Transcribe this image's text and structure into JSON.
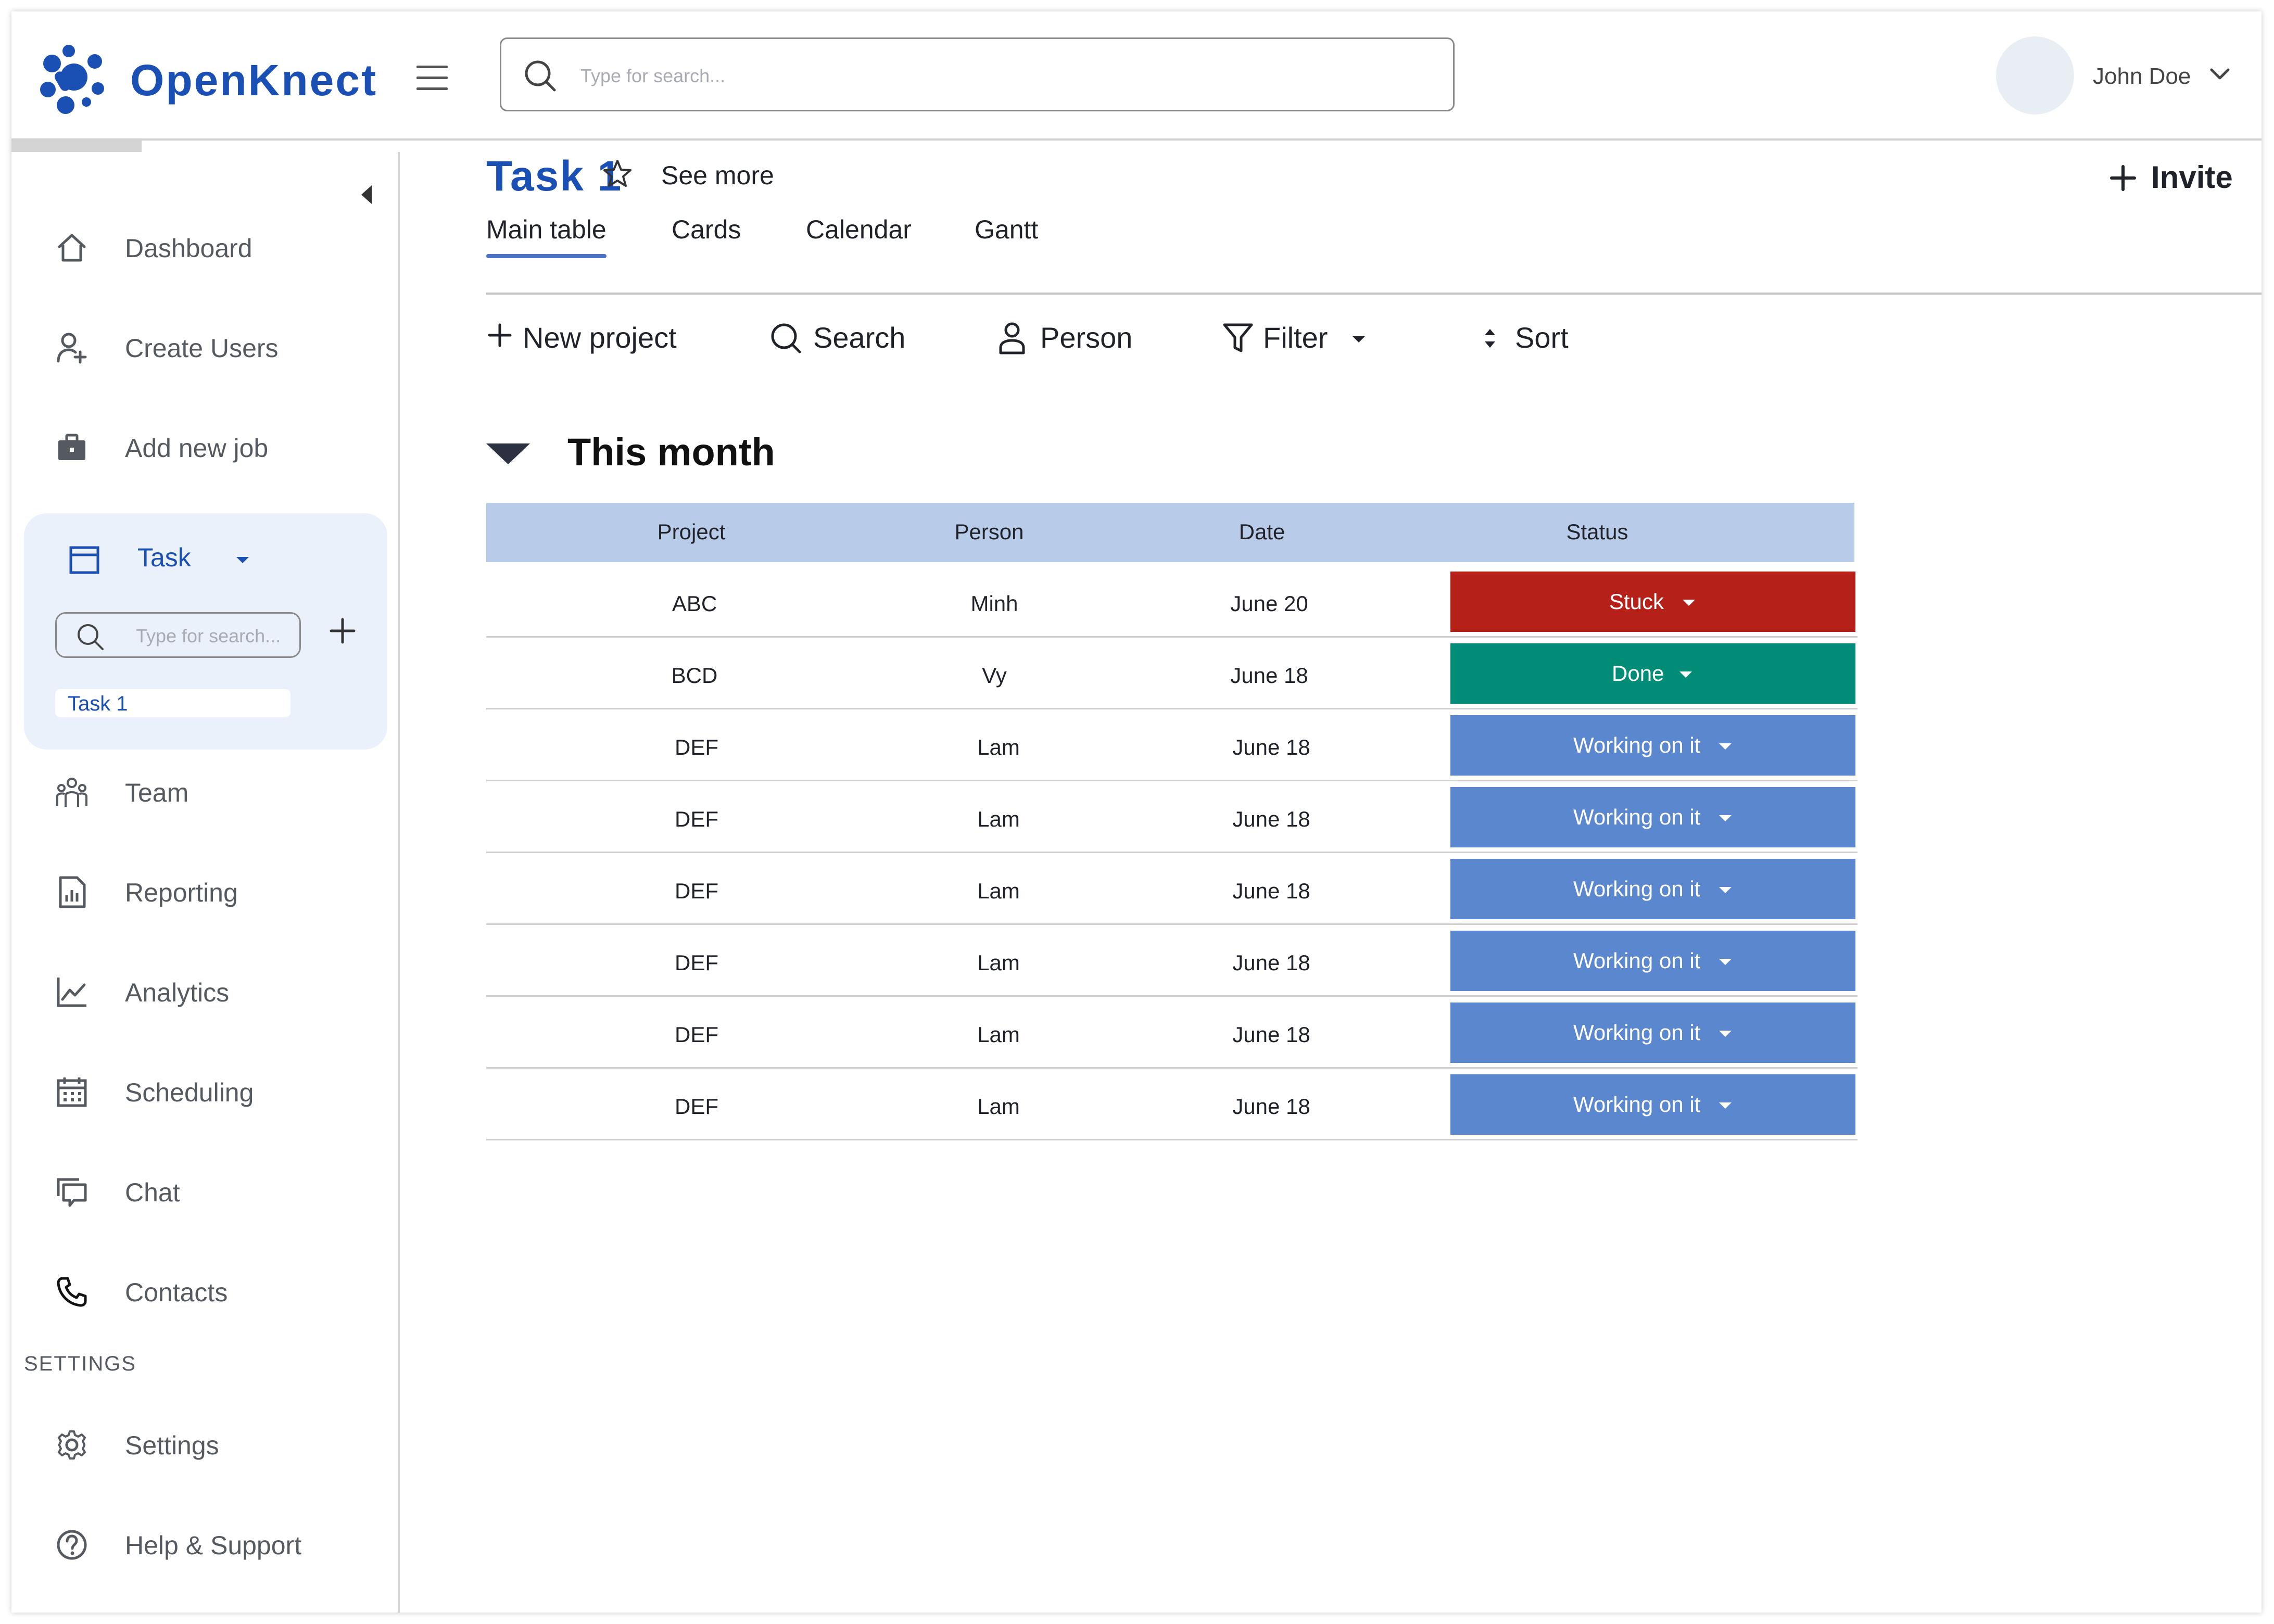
{
  "app": {
    "name": "OpenKnect",
    "brand_color": "#1a4fb3"
  },
  "header": {
    "search_placeholder": "Type for search...",
    "user_name": "John Doe"
  },
  "sidebar": {
    "items": [
      {
        "label": "Dashboard",
        "icon": "home-icon"
      },
      {
        "label": "Create Users",
        "icon": "user-add-icon"
      },
      {
        "label": "Add new job",
        "icon": "briefcase-icon"
      },
      {
        "label": "Task",
        "icon": "task-window-icon"
      },
      {
        "label": "Team",
        "icon": "team-icon"
      },
      {
        "label": "Reporting",
        "icon": "report-icon"
      },
      {
        "label": "Analytics",
        "icon": "analytics-icon"
      },
      {
        "label": "Scheduling",
        "icon": "calendar-icon"
      },
      {
        "label": "Chat",
        "icon": "chat-icon"
      },
      {
        "label": "Contacts",
        "icon": "phone-icon"
      }
    ],
    "task_search_placeholder": "Type for search...",
    "task_subitem": "Task 1",
    "settings_section": "SETTINGS",
    "settings_items": [
      {
        "label": "Settings",
        "icon": "gear-icon"
      },
      {
        "label": "Help & Support",
        "icon": "help-icon"
      }
    ]
  },
  "main": {
    "title": "Task 1",
    "see_more": "See more",
    "invite": "Invite",
    "tabs": [
      "Main table",
      "Cards",
      "Calendar",
      "Gantt"
    ],
    "active_tab": "Main table",
    "toolbar": {
      "new_project": "New project",
      "search": "Search",
      "person": "Person",
      "filter": "Filter",
      "sort": "Sort"
    },
    "group_title": "This month",
    "table": {
      "columns": [
        "Project",
        "Person",
        "Date",
        "Status"
      ],
      "rows": [
        {
          "project": "ABC",
          "person": "Minh",
          "date": "June 20",
          "status": "Stuck"
        },
        {
          "project": "BCD",
          "person": "Vy",
          "date": "June 18",
          "status": "Done"
        },
        {
          "project": "DEF",
          "person": "Lam",
          "date": "June 18",
          "status": "Working on it"
        },
        {
          "project": "DEF",
          "person": "Lam",
          "date": "June 18",
          "status": "Working on it"
        },
        {
          "project": "DEF",
          "person": "Lam",
          "date": "June 18",
          "status": "Working on it"
        },
        {
          "project": "DEF",
          "person": "Lam",
          "date": "June 18",
          "status": "Working on it"
        },
        {
          "project": "DEF",
          "person": "Lam",
          "date": "June 18",
          "status": "Working on it"
        },
        {
          "project": "DEF",
          "person": "Lam",
          "date": "June 18",
          "status": "Working on it"
        }
      ]
    },
    "status_colors": {
      "Stuck": "#b52019",
      "Done": "#008c76",
      "Working on it": "#5b87cf"
    }
  }
}
